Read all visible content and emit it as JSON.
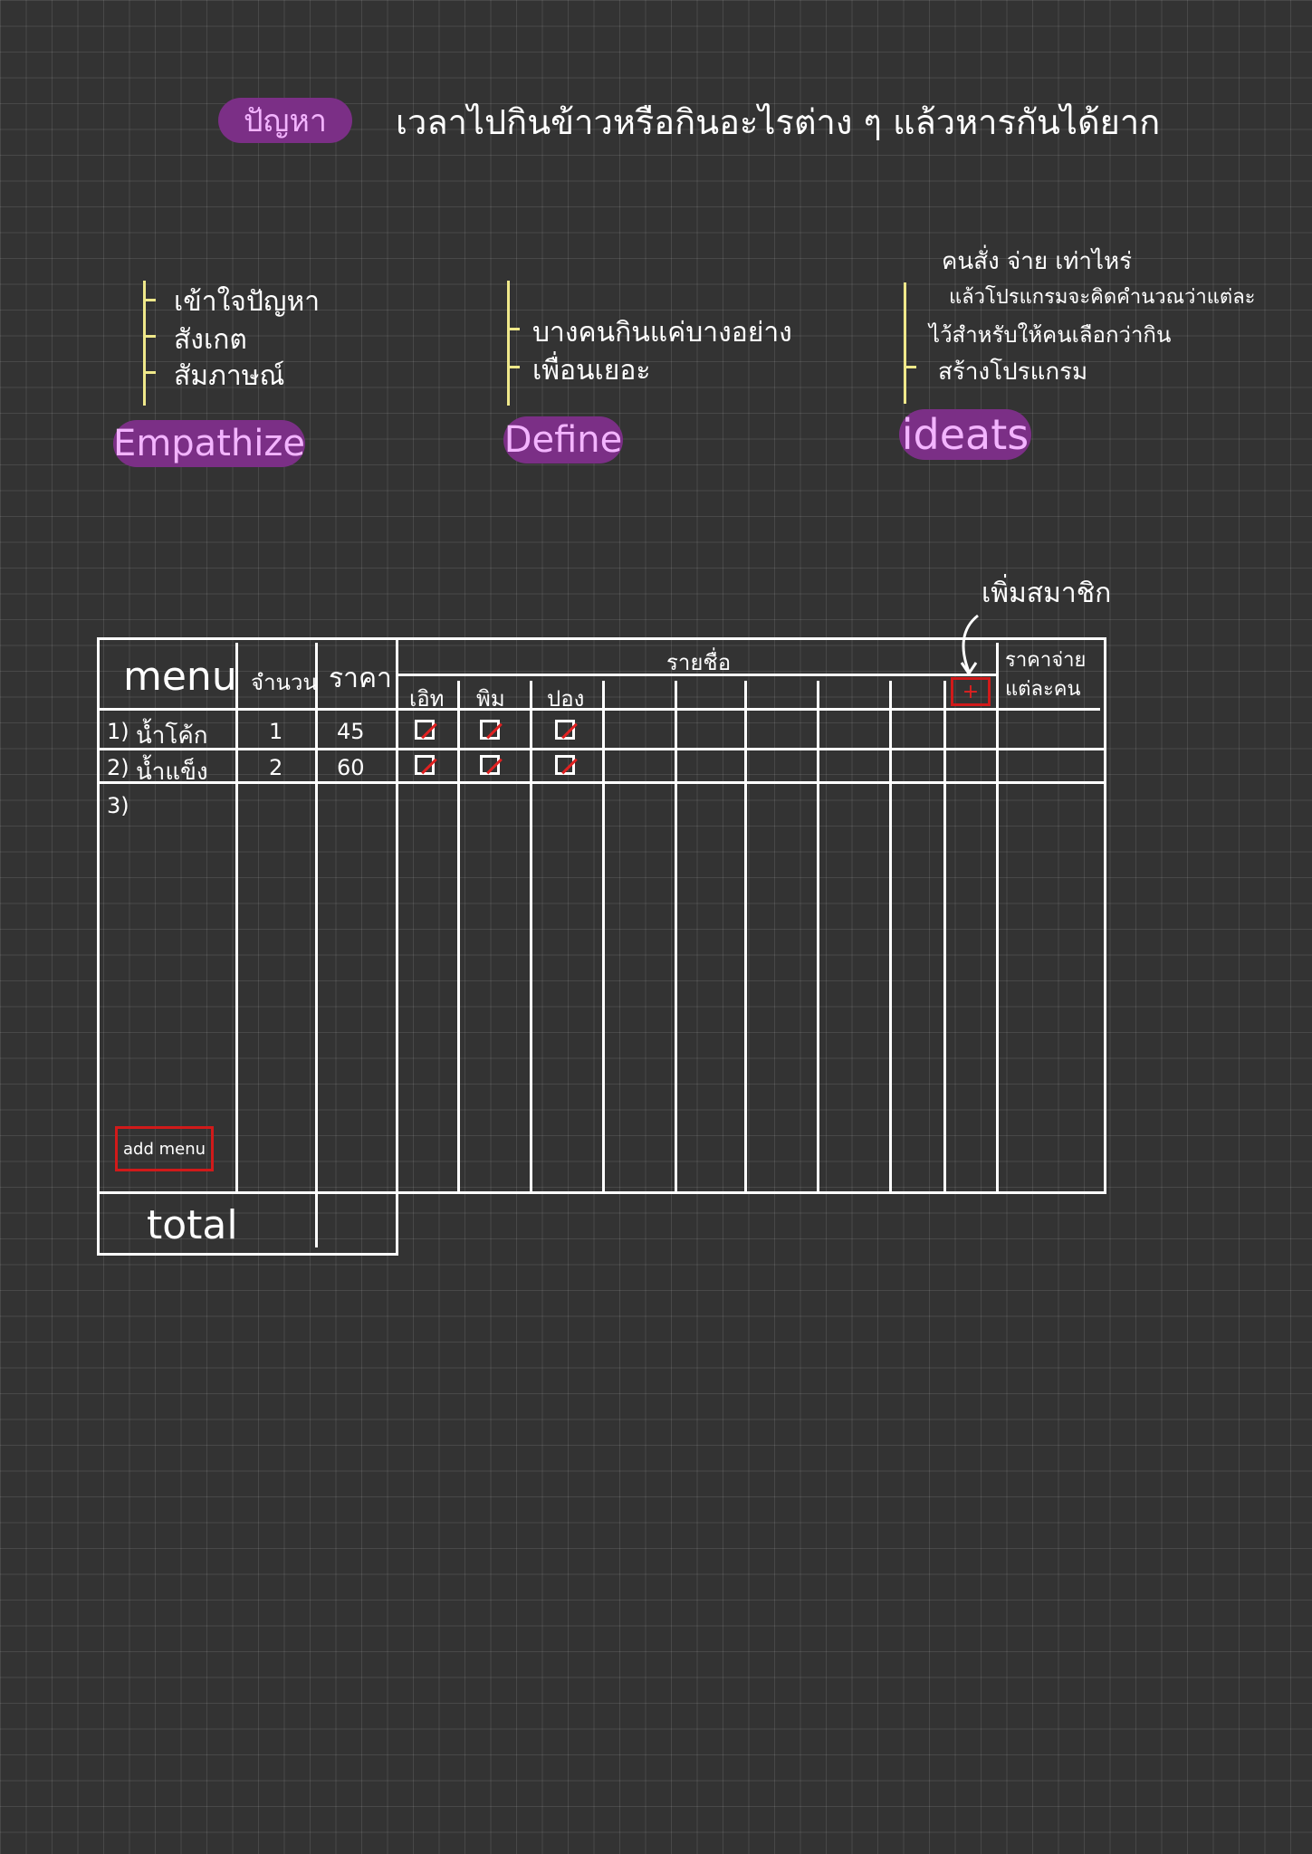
{
  "problem": {
    "tag": "ปัญหา",
    "text": "เวลาไปกินข้าวหรือกินอะไรต่าง ๆ แล้วหารกันได้ยาก"
  },
  "stages": {
    "empathize": {
      "label": "Empathize",
      "items": [
        "เข้าใจปัญหา",
        "สังเกต",
        "สัมภาษณ์"
      ]
    },
    "define": {
      "label": "Define",
      "items": [
        "บางคนกินแค่บางอย่าง",
        "เพื่อนเยอะ"
      ]
    },
    "ideate": {
      "label": "ideats",
      "items": [
        "คนสั่ง จ่าย เท่าไหร่",
        "แล้วโปรแกรมจะคิดคำนวณว่าแต่ละ",
        "ไว้สำหรับให้คนเลือกว่ากิน",
        "สร้างโปรแกรม"
      ]
    }
  },
  "annotation": {
    "add_member": "เพิ่มสมาชิก"
  },
  "table": {
    "headers": {
      "menu": "menu",
      "qty": "จำนวน",
      "price": "ราคา",
      "names": "รายชื่อ",
      "per_person": "ราคาจ่ายแต่ละคน"
    },
    "members": [
      "เอิท",
      "พิม",
      "ปอง"
    ],
    "add_member_icon": "+",
    "rows": [
      {
        "no": "1)",
        "item": "น้ำโค้ก",
        "qty": "1",
        "price": "45",
        "checks": [
          true,
          true,
          true
        ]
      },
      {
        "no": "2)",
        "item": "น้ำแข็ง",
        "qty": "2",
        "price": "60",
        "checks": [
          true,
          true,
          true
        ]
      },
      {
        "no": "3)",
        "item": "",
        "qty": "",
        "price": "",
        "checks": []
      }
    ],
    "add_menu": "add menu",
    "total": "total"
  },
  "colors": {
    "background": "#333333",
    "pill": "#7b2f86",
    "pill_text": "#f3b4ff",
    "bracket": "#efe88a",
    "accent_red": "#d11a1a"
  }
}
